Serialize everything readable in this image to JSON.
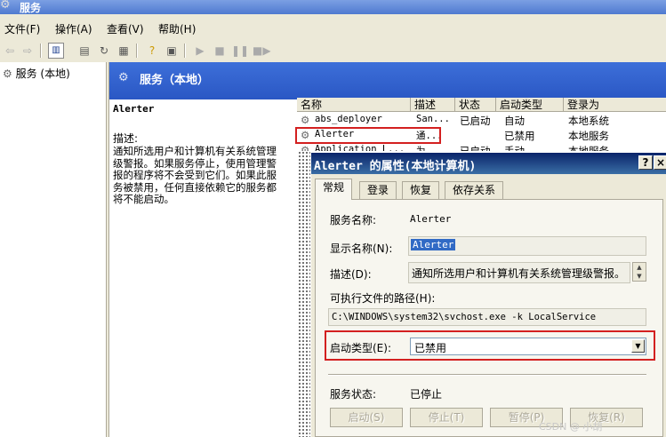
{
  "window": {
    "title": "服务"
  },
  "menu": [
    "文件(F)",
    "操作(A)",
    "查看(V)",
    "帮助(H)"
  ],
  "tree": {
    "root": "服务 (本地)"
  },
  "pane": {
    "header": "服务（本地）"
  },
  "description": {
    "service_name": "Alerter",
    "label": "描述:",
    "text": "通知所选用户和计算机有关系统管理级警报。如果服务停止，使用管理警报的程序将不会受到它们。如果此服务被禁用，任何直接依赖它的服务都将不能启动。"
  },
  "list": {
    "columns": [
      "名称",
      "描述",
      "状态",
      "启动类型",
      "登录为"
    ],
    "rows": [
      {
        "name": "abs_deployer",
        "desc": "San...",
        "status": "已启动",
        "startup": "自动",
        "logon": "本地系统"
      },
      {
        "name": "Alerter",
        "desc": "通...",
        "status": "",
        "startup": "已禁用",
        "logon": "本地服务"
      },
      {
        "name": "Application L...",
        "desc": "为...",
        "status": "已启动",
        "startup": "手动",
        "logon": "本地服务"
      }
    ]
  },
  "dialog": {
    "title": "Alerter 的属性(本地计算机)",
    "help": "?",
    "close": "×",
    "tabs": [
      "常规",
      "登录",
      "恢复",
      "依存关系"
    ],
    "service_name_label": "服务名称:",
    "service_name_value": "Alerter",
    "display_name_label": "显示名称(N):",
    "display_name_value": "Alerter",
    "description_label": "描述(D):",
    "description_value": "通知所选用户和计算机有关系统管理级警报。",
    "exe_path_label": "可执行文件的路径(H):",
    "exe_path_value": "C:\\WINDOWS\\system32\\svchost.exe -k LocalService",
    "startup_type_label": "启动类型(E):",
    "startup_type_value": "已禁用",
    "service_status_label": "服务状态:",
    "service_status_value": "已停止",
    "buttons": [
      "启动(S)",
      "停止(T)",
      "暂停(P)",
      "恢复(R)"
    ]
  },
  "watermark": "CSDN @ 小胡"
}
